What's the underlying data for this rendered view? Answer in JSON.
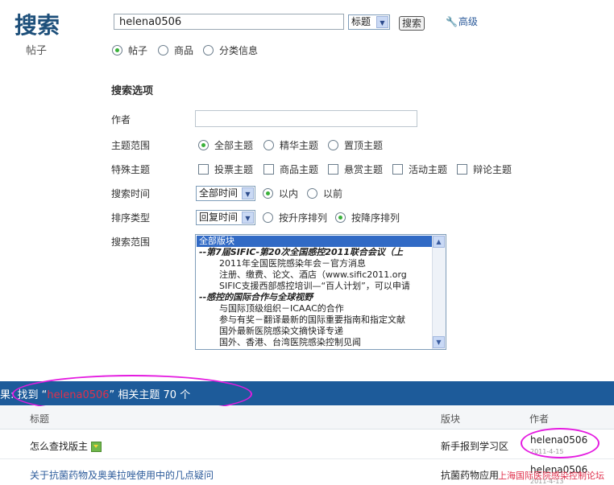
{
  "header": {
    "title": "搜索",
    "subtitle": "帖子"
  },
  "search": {
    "query": "helena0506",
    "field_select": "标题",
    "submit_label": "搜索",
    "advanced_label": "高级",
    "types": [
      {
        "label": "帖子",
        "checked": true
      },
      {
        "label": "商品",
        "checked": false
      },
      {
        "label": "分类信息",
        "checked": false
      }
    ]
  },
  "options": {
    "section_title": "搜索选项",
    "author_label": "作者",
    "author_value": "",
    "scope_label": "主题范围",
    "scope_options": [
      {
        "label": "全部主题",
        "checked": true
      },
      {
        "label": "精华主题",
        "checked": false
      },
      {
        "label": "置顶主题",
        "checked": false
      }
    ],
    "special_label": "特殊主题",
    "special_options": [
      {
        "label": "投票主题",
        "checked": false
      },
      {
        "label": "商品主题",
        "checked": false
      },
      {
        "label": "悬赏主题",
        "checked": false
      },
      {
        "label": "活动主题",
        "checked": false
      },
      {
        "label": "辩论主题",
        "checked": false
      }
    ],
    "time_label": "搜索时间",
    "time_select": "全部时间",
    "time_options": [
      {
        "label": "以内",
        "checked": true
      },
      {
        "label": "以前",
        "checked": false
      }
    ],
    "sort_label": "排序类型",
    "sort_select": "回复时间",
    "sort_options": [
      {
        "label": "按升序排列",
        "checked": false
      },
      {
        "label": "按降序排列",
        "checked": true
      }
    ],
    "range_label": "搜索范围",
    "forum_list": [
      {
        "text": "全部版块",
        "kind": "sel"
      },
      {
        "text": "--第7届SIFIC-第20次全国感控2011联合会议（上",
        "kind": "grp"
      },
      {
        "text": "2011年全国医院感染年会－官方消息",
        "kind": "sub"
      },
      {
        "text": "注册、缴费、论文、酒店（www.sific2011.org",
        "kind": "sub"
      },
      {
        "text": "SIFIC支援西部感控培训—“百人计划”，可以申请",
        "kind": "sub"
      },
      {
        "text": "--感控的国际合作与全球视野",
        "kind": "grp"
      },
      {
        "text": "与国际顶级组织－ICAAC的合作",
        "kind": "sub"
      },
      {
        "text": "参与有奖－翻译最新的国际重要指南和指定文献",
        "kind": "sub"
      },
      {
        "text": "国外最新医院感染文摘快译专递",
        "kind": "sub"
      },
      {
        "text": "国外、香港、台湾医院感染控制见闻",
        "kind": "sub"
      }
    ]
  },
  "results": {
    "prefix": "果: 找到 “",
    "keyword": "helena0506",
    "suffix": "” 相关主题 70 个",
    "columns": {
      "title": "标题",
      "forum": "版块",
      "author": "作者"
    },
    "rows": [
      {
        "title": "怎么查找版主",
        "forum": "新手报到学习区",
        "author": "helena0506",
        "date": "2011-4-15",
        "has_icon": true
      },
      {
        "title": "关于抗菌药物及奥美拉唑使用中的几点疑问",
        "forum": "抗菌药物应用",
        "author": "helena0506",
        "date": "2011-4-13",
        "has_icon": false
      }
    ]
  },
  "watermark": "上海国际医院感染控制论坛",
  "colors": {
    "brand": "#1d4f7a",
    "result_bar": "#1d5b9a",
    "highlight": "#e41be0",
    "keyword": "#e0304c"
  }
}
